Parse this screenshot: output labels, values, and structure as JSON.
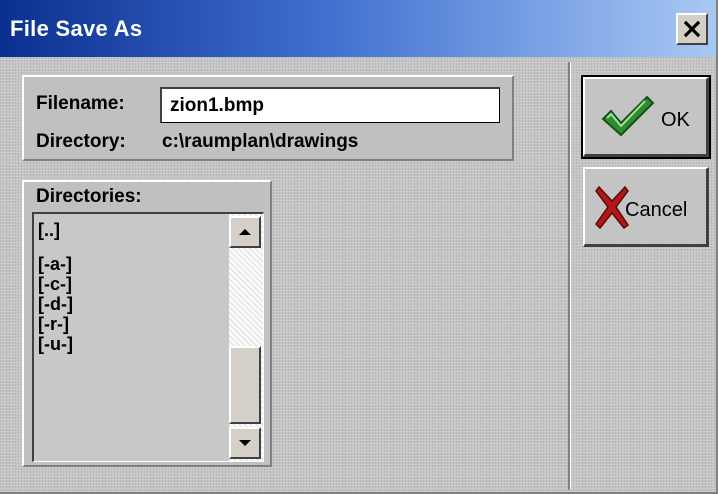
{
  "window": {
    "title": "File Save As",
    "close_icon": "close-icon"
  },
  "file": {
    "filename_label": "Filename:",
    "filename_value": "zion1.bmp",
    "directory_label": "Directory:",
    "directory_value": "c:\\raumplan\\drawings"
  },
  "directories": {
    "label": "Directories:",
    "items": [
      {
        "label": "[..]"
      },
      {
        "label": "[-a-]"
      },
      {
        "label": "[-c-]"
      },
      {
        "label": "[-d-]"
      },
      {
        "label": "[-r-]"
      },
      {
        "label": "[-u-]"
      }
    ]
  },
  "buttons": {
    "ok_label": "OK",
    "ok_icon": "checkmark-icon",
    "cancel_label": "Cancel",
    "cancel_icon": "x-mark-icon"
  },
  "colors": {
    "titlebar_start": "#0b2f8f",
    "titlebar_end": "#a9c9f4",
    "ok_check": "#2e8b2e",
    "cancel_x": "#b01818"
  }
}
